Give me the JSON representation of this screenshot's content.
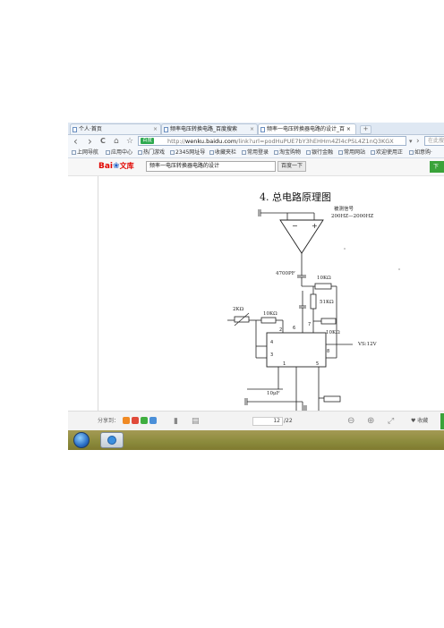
{
  "tabs": [
    {
      "label": "个人·首页",
      "close": "×"
    },
    {
      "label": "频率电压转换电路_百度搜索",
      "close": "×"
    },
    {
      "label": "频率一电压转换器电路的设计_百 ×",
      "close": ""
    }
  ],
  "nav": {
    "back": "‹",
    "forward": "›",
    "refresh": "C",
    "home": "⌂",
    "star": "☆",
    "shield_label": "百度",
    "url_scheme": "http://",
    "url_host": "wenku.baidu.com",
    "url_path": "/link?url=podHuPUE7bY3hEHHm4Zl4cPSL4Z1nQ3KGX",
    "search_placeholder": "在此搜"
  },
  "bookmarks": [
    "上网导航",
    "应用中心",
    "热门游戏",
    "2345网址导",
    "收藏夹栏",
    "常用登录",
    "淘宝购物",
    "银行金融",
    "常用网站",
    "欢迎使用正",
    "如意购·"
  ],
  "wenku": {
    "logo_bai": "Bai",
    "logo_paw": "du",
    "logo_wenku": "文库",
    "search_value": "频率一电压转换器电路的设计",
    "search_button": "百度一下",
    "right_button": "下"
  },
  "document": {
    "heading": "4. 总电路原理图",
    "labels": {
      "signal_title": "被测信号",
      "signal_range": "200HZ—2000HZ",
      "minus": "−",
      "plus": "+",
      "c1": "4700PF",
      "r_top": "10KΩ",
      "r_51k": "51KΩ",
      "r_2k": "2KΩ",
      "r_10k_a": "10KΩ",
      "r_10k_b": "10KΩ",
      "pin2": "2",
      "pin3": "3",
      "pin4": "4",
      "pin1": "1",
      "pin5": "5",
      "pin6": "6",
      "pin7": "7",
      "pin8": "8",
      "vs": "VS:12V",
      "c2": "10μF"
    }
  },
  "bottom": {
    "share_label": "分享到：",
    "page_current": "12",
    "page_total": "/22",
    "collect_label": "♥ 收藏"
  },
  "colors": {
    "tab_bg": "#dfe8f3",
    "baidu_red": "#e10601",
    "baidu_blue": "#2060c8",
    "green": "#3aa33a",
    "taskbar": "#8b8a3c"
  }
}
